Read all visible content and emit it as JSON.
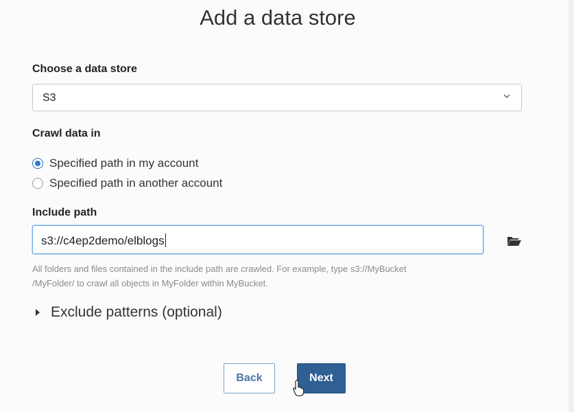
{
  "dialog": {
    "title": "Add a data store"
  },
  "data_store": {
    "label": "Choose a data store",
    "selected": "S3"
  },
  "crawl": {
    "label": "Crawl data in",
    "options": [
      {
        "label": "Specified path in my account",
        "checked": true
      },
      {
        "label": "Specified path in another account",
        "checked": false
      }
    ]
  },
  "include_path": {
    "label": "Include path",
    "value": "s3://c4ep2demo/elblogs",
    "help_line1": "All folders and files contained in the include path are crawled. For example, type s3://MyBucket",
    "help_line2": "/MyFolder/ to crawl all objects in MyFolder within MyBucket."
  },
  "exclude": {
    "label": "Exclude patterns (optional)"
  },
  "buttons": {
    "back": "Back",
    "next": "Next"
  },
  "colors": {
    "accent": "#2f5f93",
    "radio_checked": "#2f7ad1",
    "focus_border": "#6aa6e8"
  }
}
